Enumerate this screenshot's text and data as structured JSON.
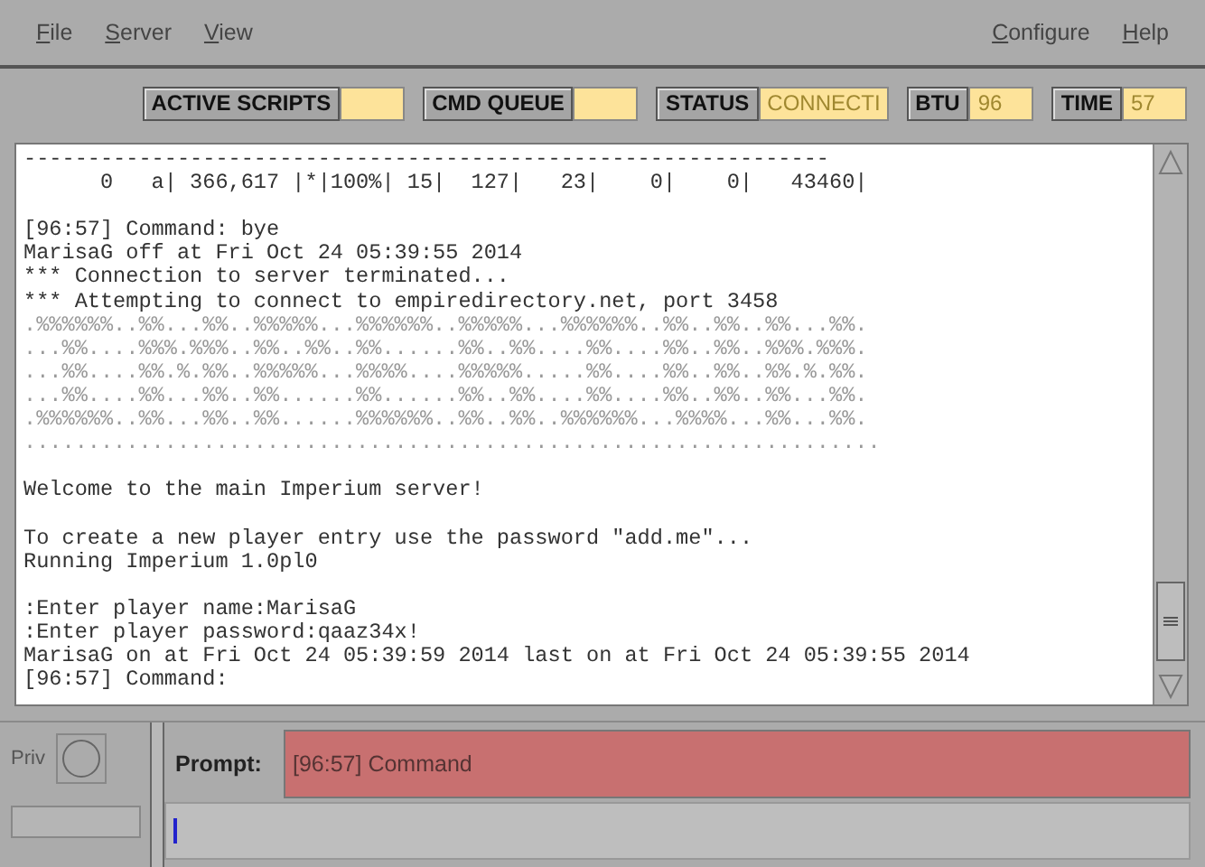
{
  "menu_left": [
    {
      "label": "File"
    },
    {
      "label": "Server"
    },
    {
      "label": "View"
    }
  ],
  "menu_right": [
    {
      "label": "Configure"
    },
    {
      "label": "Help"
    }
  ],
  "status_fields": [
    {
      "label": "ACTIVE SCRIPTS"
    },
    {
      "label": "CMD QUEUE"
    },
    {
      "label": "STATUS",
      "value": "CONNECTI"
    },
    {
      "label": "BTU",
      "value": "96"
    },
    {
      "label": "TIME",
      "value": "57"
    }
  ],
  "terminal_lines": [
    {
      "kind": "text",
      "text": "---------------------------------------------------------------"
    },
    {
      "kind": "text",
      "text": "      0   a| 366,617 |*|100%| 15|  127|   23|    0|    0|   43460|"
    },
    {
      "kind": "blank"
    },
    {
      "kind": "text",
      "text": "[96:57] Command: bye"
    },
    {
      "kind": "text",
      "text": "MarisaG off at Fri Oct 24 05:39:55 2014"
    },
    {
      "kind": "text",
      "text": "*** Connection to server terminated..."
    },
    {
      "kind": "text",
      "text": "*** Attempting to connect to empiredirectory.net, port 3458"
    },
    {
      "kind": "art",
      "text": ".%%%%%%..%%...%%..%%%%%...%%%%%%..%%%%%...%%%%%%..%%..%%..%%...%%."
    },
    {
      "kind": "art",
      "text": "...%%....%%%.%%%..%%..%%..%%......%%..%%....%%....%%..%%..%%%.%%%."
    },
    {
      "kind": "art",
      "text": "...%%....%%.%.%%..%%%%%...%%%%....%%%%%.....%%....%%..%%..%%.%.%%."
    },
    {
      "kind": "art",
      "text": "...%%....%%...%%..%%......%%......%%..%%....%%....%%..%%..%%...%%."
    },
    {
      "kind": "art",
      "text": ".%%%%%%..%%...%%..%%......%%%%%%..%%..%%..%%%%%%...%%%%...%%...%%."
    },
    {
      "kind": "art",
      "text": "..................................................................."
    },
    {
      "kind": "blank"
    },
    {
      "kind": "text",
      "text": "Welcome to the main Imperium server!"
    },
    {
      "kind": "blank"
    },
    {
      "kind": "text",
      "text": "To create a new player entry use the password \"add.me\"..."
    },
    {
      "kind": "text",
      "text": "Running Imperium 1.0pl0"
    },
    {
      "kind": "blank"
    },
    {
      "kind": "text",
      "text": ":Enter player name:MarisaG"
    },
    {
      "kind": "text",
      "text": ":Enter player password:qaaz34x!"
    },
    {
      "kind": "text",
      "text": "MarisaG on at Fri Oct 24 05:39:59 2014 last on at Fri Oct 24 05:39:55 2014"
    },
    {
      "kind": "text",
      "text": "[96:57] Command:"
    }
  ],
  "priv": {
    "label": "Priv"
  },
  "prompt": {
    "label": "Prompt:",
    "text": "[96:57] Command"
  }
}
